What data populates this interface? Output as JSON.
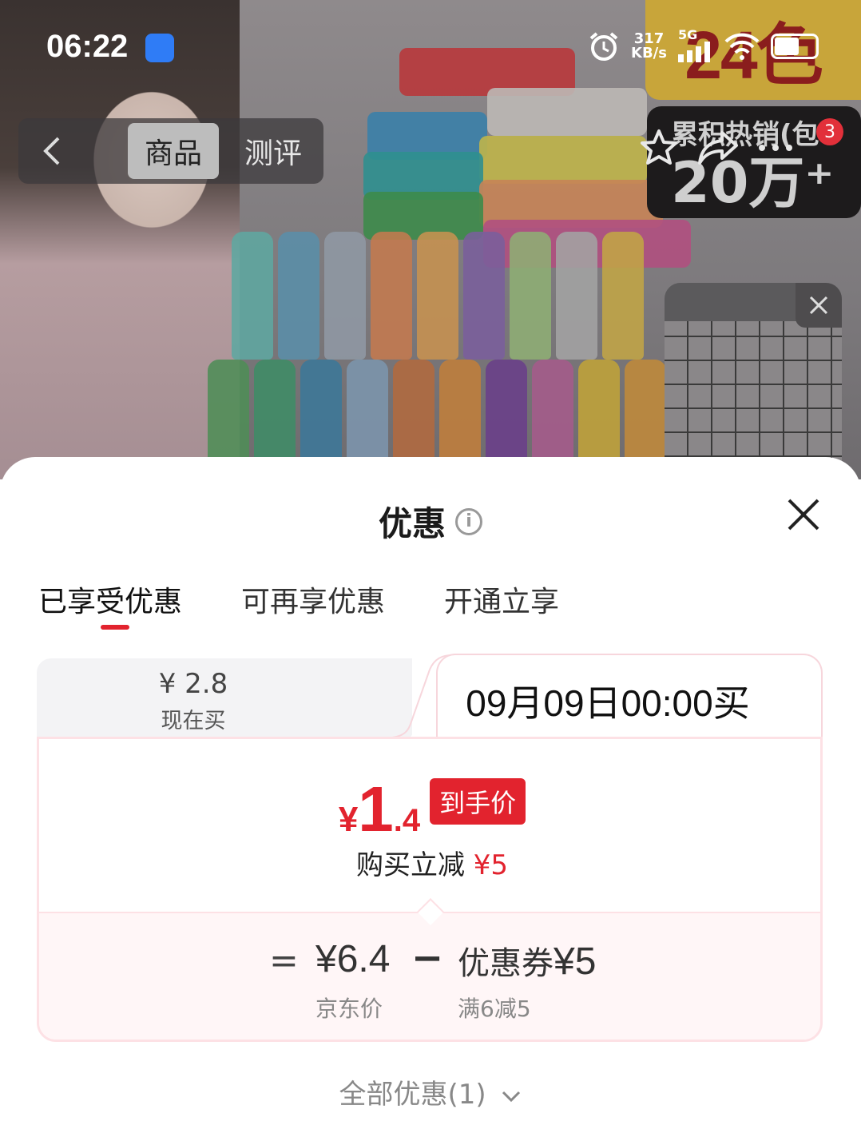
{
  "status_bar": {
    "time": "06:22",
    "net_speed_value": "317",
    "net_speed_unit": "KB/s",
    "network": "5G"
  },
  "header": {
    "tab_goods": "商品",
    "tab_review": "测评",
    "cart_count": "3"
  },
  "banner": {
    "colors_badge": "24色",
    "sales_line1": "累积热销(包",
    "sales_line2": "20万⁺"
  },
  "sheet": {
    "title": "优惠",
    "tabs": [
      "已享受优惠",
      "可再享优惠",
      "开通立享"
    ],
    "active_tab": 0,
    "now": {
      "price": "¥ 2.8",
      "label": "现在买"
    },
    "future": {
      "time_label": "09月09日00:00买",
      "price_symbol": "¥",
      "price_int": "1",
      "price_dec": ".4",
      "price_tag": "到手价",
      "reduce_label": "购买立减",
      "reduce_value": "¥5",
      "eq": "=",
      "jd_price": "¥6.4",
      "jd_label": "京东价",
      "minus": "−",
      "coupon_label": "优惠券",
      "coupon_value": "¥5",
      "coupon_rule": "满6减5"
    },
    "all_offers": "全部优惠(1)"
  },
  "colors": {
    "accent_red": "#e2232e",
    "border_pink": "#fde1e5"
  }
}
